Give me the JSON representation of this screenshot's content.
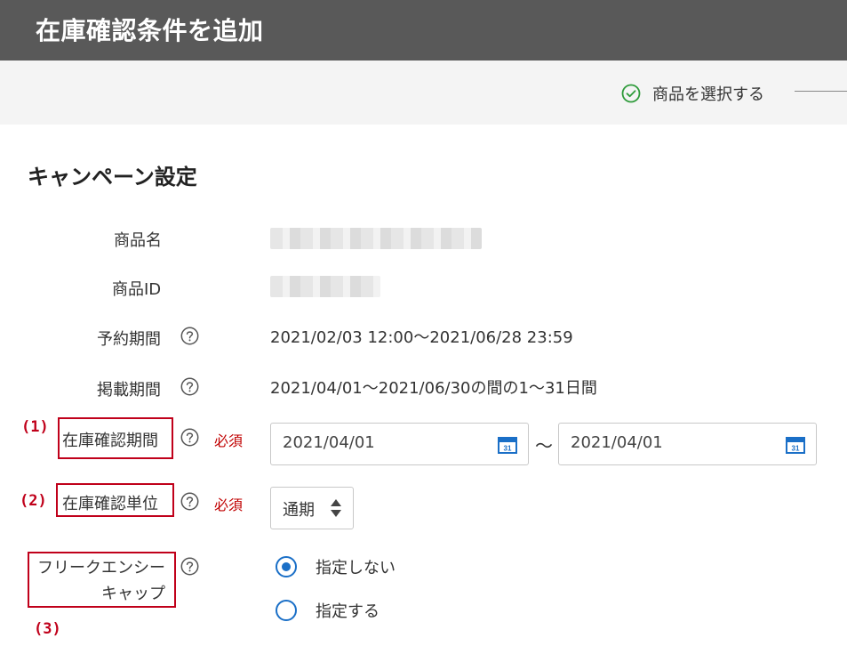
{
  "header": {
    "title": "在庫確認条件を追加"
  },
  "steps": {
    "step1_label": "商品を選択する"
  },
  "section": {
    "title": "キャンペーン設定"
  },
  "fields": {
    "product_name_label": "商品名",
    "product_id_label": "商品ID",
    "reservation_label": "予約期間",
    "reservation_value": "2021/02/03 12:00～2021/06/28 23:59",
    "listing_label": "掲載期間",
    "listing_value": "2021/04/01～2021/06/30の間の1～31日間",
    "stock_period_label": "在庫確認期間",
    "required_text": "必須",
    "stock_period_start": "2021/04/01",
    "range_separator": "～",
    "stock_period_end": "2021/04/01",
    "stock_unit_label": "在庫確認単位",
    "stock_unit_value": "通期",
    "frequency_cap_label_line1": "フリークエンシー",
    "frequency_cap_label_line2": "キャップ",
    "frequency_options": [
      "指定しない",
      "指定する"
    ],
    "frequency_selected": "指定しない"
  },
  "annotations": {
    "marker1": "(1)",
    "marker2": "(2)",
    "marker3": "(3)"
  },
  "icons": {
    "help": "help-icon",
    "calendar": "calendar-icon",
    "check": "check-circle-icon",
    "sort": "sort-arrows-icon"
  },
  "colors": {
    "accent": "#1a6fc7",
    "required": "#c00000",
    "annotation": "#c0001a",
    "check": "#2e9b3a",
    "header_bg": "#595959"
  }
}
